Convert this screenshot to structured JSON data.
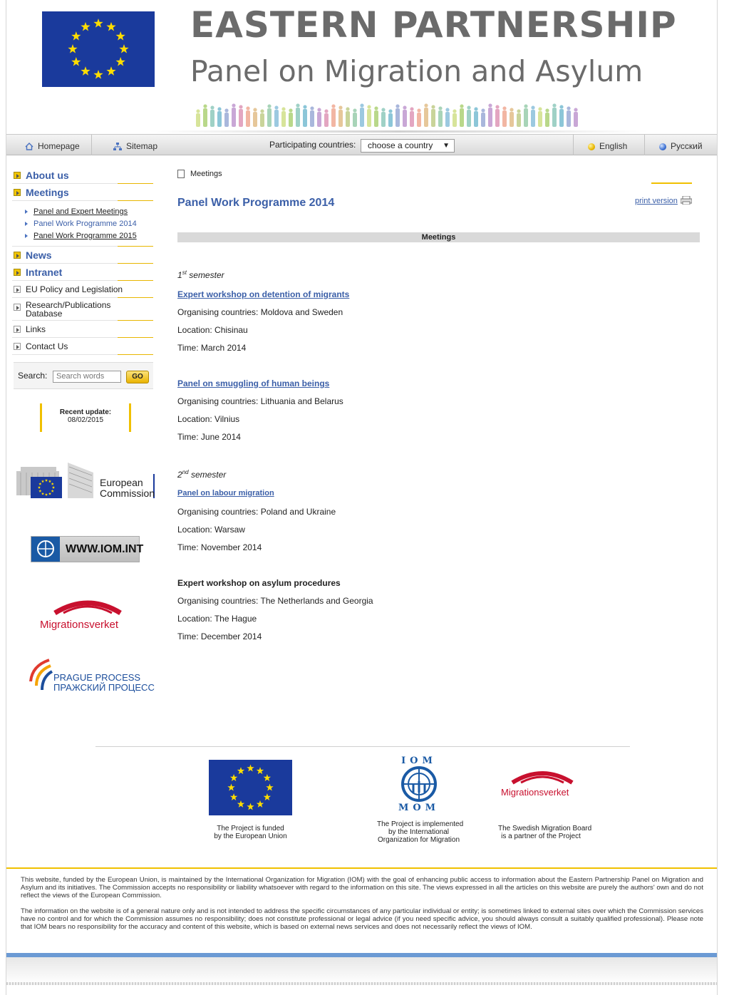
{
  "header": {
    "title_line1": "EASTERN PARTNERSHIP",
    "title_line2": "Panel on Migration and Asylum"
  },
  "nav": {
    "home_label": "Homepage",
    "sitemap_label": "Sitemap",
    "countries_label": "Participating countries:",
    "countries_selected": "choose a country",
    "english_label": "English",
    "russian_label": "Русский"
  },
  "sidebar": {
    "items": [
      {
        "label": "About us"
      },
      {
        "label": "Meetings"
      },
      {
        "label": "News"
      },
      {
        "label": "Intranet"
      },
      {
        "label": "EU Policy and Legislation"
      },
      {
        "label": "Research/Publications Database"
      },
      {
        "label": "Links"
      },
      {
        "label": "Contact Us"
      }
    ],
    "sub_items": [
      {
        "label": "Panel and Expert Meetings"
      },
      {
        "label": "Panel Work Programme 2014"
      },
      {
        "label": "Panel Work Programme 2015"
      }
    ],
    "search_label": "Search:",
    "search_placeholder": "Search words",
    "search_button": "GO",
    "update_label": "Recent update:",
    "update_date": "08/02/2015"
  },
  "logos": {
    "ec_line1": "European",
    "ec_line2": "Commission",
    "iom_text": "WWW.IOM.INT",
    "migrationsverket": "Migrationsverket",
    "prague_line1": "PRAGUE PROCESS",
    "prague_line2": "ПРАЖСКИЙ ПРОЦЕСС"
  },
  "content": {
    "breadcrumb": "Meetings",
    "title": "Panel Work Programme 2014",
    "print": "print version",
    "bar_title": "Meetings",
    "sem1_num": "1",
    "sem1_sup": "st",
    "sem1_text": "semester",
    "sem2_num": "2",
    "sem2_sup": "nd",
    "sem2_text": "semester",
    "meetings": [
      {
        "title": "Expert workshop on detention of migrants",
        "organisers": "Organising countries:  Moldova and Sweden",
        "location": "Location: Chisinau",
        "time": "Time:  March 2014"
      },
      {
        "title": "Panel on smuggling of human beings",
        "organisers": "Organising countries: Lithuania and Belarus",
        "location": "Location: Vilnius",
        "time": "Time: June 2014"
      },
      {
        "title": "Panel on labour migration",
        "organisers": "Organising countries: Poland and Ukraine",
        "location": "Location: Warsaw",
        "time": "Time: November 2014"
      },
      {
        "title": "Expert workshop on asylum procedures",
        "organisers": "Organising countries: The Netherlands and Georgia",
        "location": "Location: The Hague",
        "time": "Time: December 2014"
      }
    ]
  },
  "footer": {
    "eu_cap1": "The Project is funded",
    "eu_cap2": "by the European Union",
    "iom_top": "IOM",
    "iom_bottom": "MOM",
    "iom_cap1": "The Project is implemented",
    "iom_cap2": "by the International",
    "iom_cap3": "Organization for Migration",
    "mig_text": "Migrationsverket",
    "mig_cap1": "The Swedish Migration Board",
    "mig_cap2": "is a partner of the Project",
    "disclaimer1": "This website, funded by the European Union, is maintained by the International Organization for Migration (IOM) with the goal of enhancing public access to information about the Eastern Partnership Panel on Migration and Asylum and its initiatives. The Commission accepts no responsibility or liability whatsoever with regard to the information on this site. The views expressed in all the articles on this website are purely the authors' own and do not reflect the views of the European Commission.",
    "disclaimer2": "The information on the website is of a general nature only and is not intended to address the specific circumstances of any particular individual or entity; is sometimes linked to external sites over which the Commission services have no control and for which the Commission assumes no responsibility; does not constitute professional or legal advice (if you need specific advice, you should always consult a suitably qualified professional). Please note that IOM bears no responsibility for the accuracy and content of this website, which is based on external news services and does not necessarily reflect the views of IOM."
  },
  "colors": {
    "accent_blue": "#3b5fa8",
    "eu_blue": "#1a3a9c",
    "eu_star": "#ffdd00",
    "accent_yellow": "#f0c000",
    "mig_red": "#c8102e"
  }
}
